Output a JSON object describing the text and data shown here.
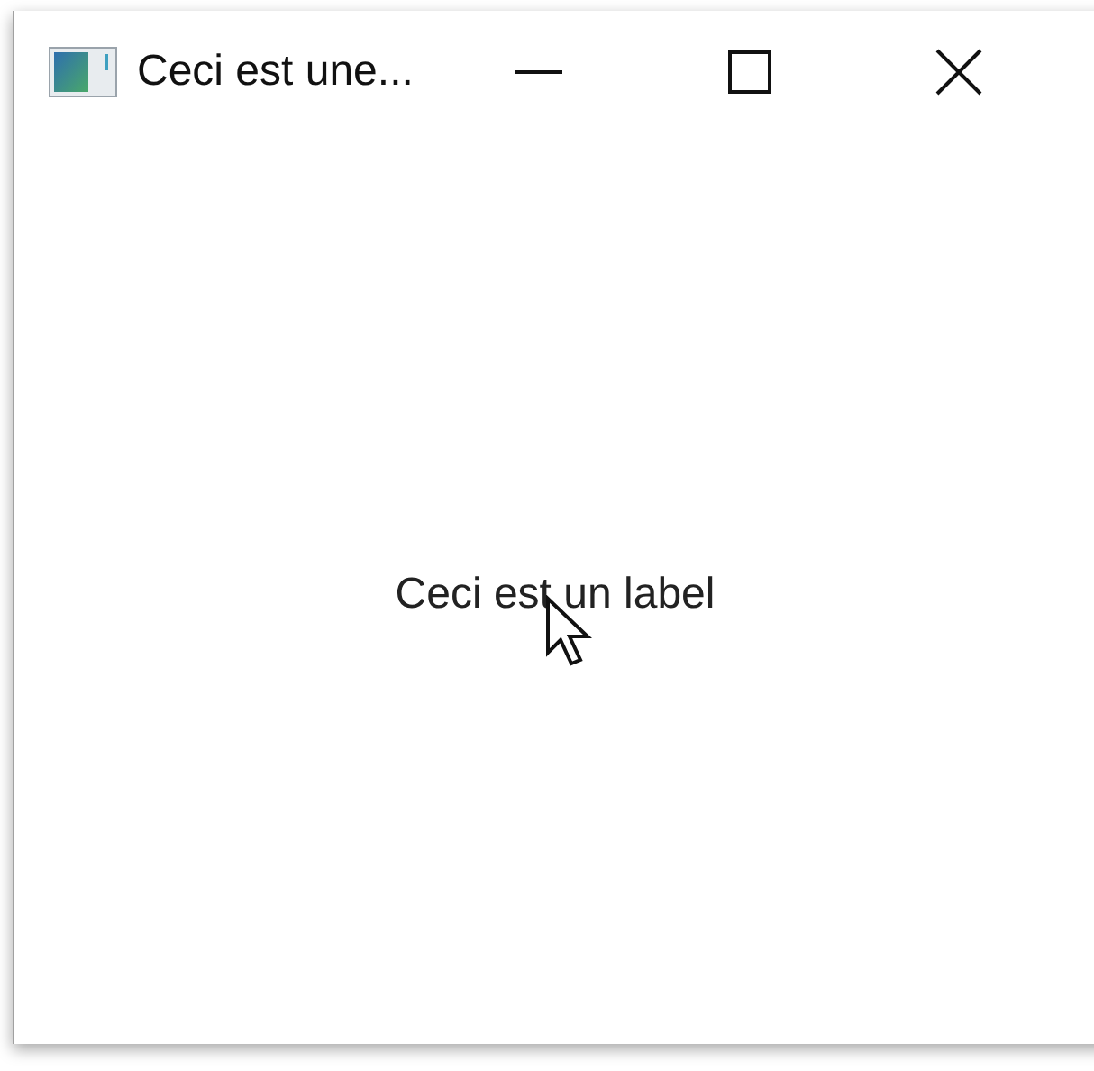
{
  "window": {
    "title": "Ceci est une..."
  },
  "label": {
    "text": "Ceci est un label"
  }
}
